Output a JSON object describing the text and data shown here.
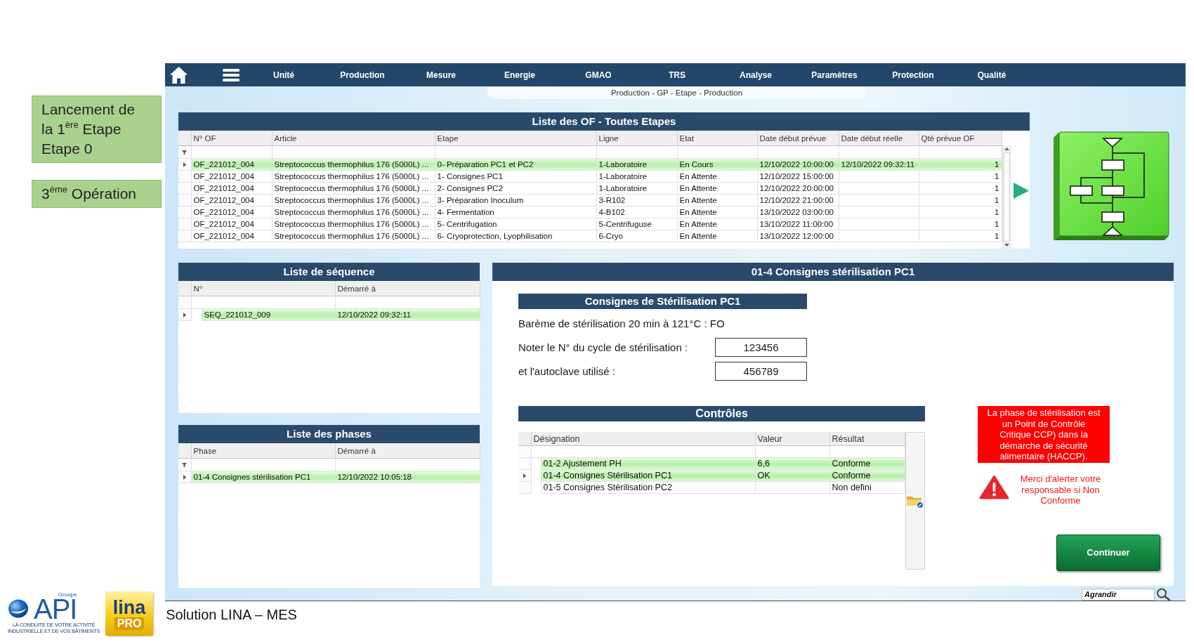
{
  "annotations": [
    {
      "lines": [
        "Lancement de la 1$^{ère}$ Etape",
        "Etape 0"
      ]
    },
    {
      "lines": [
        "3$^{ème}$ Opération"
      ]
    }
  ],
  "nav": {
    "items": [
      "Unité",
      "Production",
      "Mesure",
      "Energie",
      "GMAO",
      "TRS",
      "Analyse",
      "Paramètres",
      "Protection",
      "Qualité"
    ]
  },
  "breadcrumb": "Production - GP - Etape - Production",
  "of_list": {
    "title": "Liste des OF - Toutes Etapes",
    "columns": [
      "N° OF",
      "Article",
      "Etape",
      "Ligne",
      "Etat",
      "Date début prévue",
      "Date début réelle",
      "Qté prévue OF"
    ],
    "filter_icon": true,
    "rows": [
      {
        "selected": true,
        "highlighted": true,
        "cells": [
          "OF_221012_004",
          "Streptococcus thermophilus 176 (5000L) ...",
          "0- Préparation PC1 et PC2",
          "1-Laboratoire",
          "En Cours",
          "12/10/2022 10:00:00",
          "12/10/2022 09:32:11",
          "1"
        ]
      },
      {
        "selected": false,
        "highlighted": false,
        "cells": [
          "OF_221012_004",
          "Streptococcus thermophilus 176 (5000L) ...",
          "1- Consignes PC1",
          "1-Laboratoire",
          "En Attente",
          "12/10/2022 15:00:00",
          null,
          "1"
        ]
      },
      {
        "selected": false,
        "highlighted": false,
        "cells": [
          "OF_221012_004",
          "Streptococcus thermophilus 176 (5000L) ...",
          "2- Consignes PC2",
          "1-Laboratoire",
          "En Attente",
          "12/10/2022 20:00:00",
          null,
          "1"
        ]
      },
      {
        "selected": false,
        "highlighted": false,
        "cells": [
          "OF_221012_004",
          "Streptococcus thermophilus 176 (5000L) ...",
          "3- Préparation Inoculum",
          "3-R102",
          "En Attente",
          "12/10/2022 21:00:00",
          null,
          "1"
        ]
      },
      {
        "selected": false,
        "highlighted": false,
        "cells": [
          "OF_221012_004",
          "Streptococcus thermophilus 176 (5000L) ...",
          "4- Fermentation",
          "4-B102",
          "En Attente",
          "13/10/2022 03:00:00",
          null,
          "1"
        ]
      },
      {
        "selected": false,
        "highlighted": false,
        "cells": [
          "OF_221012_004",
          "Streptococcus thermophilus 176 (5000L) ...",
          "5- Centrifugation",
          "5-Centrifuguse",
          "En Attente",
          "13/10/2022 11:00:00",
          null,
          "1"
        ]
      },
      {
        "selected": false,
        "highlighted": false,
        "cells": [
          "OF_221012_004",
          "Streptococcus thermophilus 176 (5000L) ...",
          "6- Cryoprotection, Lyophilisation",
          "6-Cryo",
          "En Attente",
          "13/10/2022 12:00:00",
          null,
          "1"
        ]
      }
    ]
  },
  "sequence_list": {
    "title": "Liste de séquence",
    "columns": [
      "N°",
      "Démarré à"
    ],
    "filter_icon": false,
    "rows": [
      {
        "selected": true,
        "highlighted": true,
        "cells": [
          "SEQ_221012_009",
          "12/10/2022 09:32:11"
        ]
      }
    ]
  },
  "phase_list": {
    "title": "Liste des phases",
    "columns": [
      "Phase",
      "Démarré à"
    ],
    "filter_icon": true,
    "rows": [
      {
        "selected": true,
        "highlighted": true,
        "cells": [
          "01-4 Consignes stérilisation PC1",
          "12/10/2022 10:05:18"
        ]
      }
    ]
  },
  "detail": {
    "title": "01-4 Consignes stérilisation PC1",
    "instructions": {
      "title": "Consignes de Stérilisation PC1",
      "scale": "Barème de stérilisation 20 min à 121°C : FO",
      "fields": [
        {
          "label": "Noter le N° du cycle de stérilisation :",
          "value": "123456"
        },
        {
          "label": "et l'autoclave utilisé :",
          "value": "456789"
        }
      ]
    },
    "controls": {
      "title": "Contrôles",
      "columns": [
        "Désignation",
        "Valeur",
        "Résultat"
      ],
      "filter_icon": false,
      "rows": [
        {
          "selected": false,
          "highlighted": true,
          "cells": [
            "01-2 Ajustement PH",
            "6,6",
            "Conforme"
          ]
        },
        {
          "selected": true,
          "highlighted": true,
          "cells": [
            "01-4 Consignes Stérilisation PC1",
            "OK",
            "Conforme"
          ]
        },
        {
          "selected": false,
          "highlighted": false,
          "cells": [
            "01-5 Consignes Stérilisation PC2",
            null,
            "Non defini"
          ]
        }
      ]
    },
    "alert": "La phase de stérilisation est un Point de Contrôle Critique CCP) dans la démarche de sécurité alimentaire (HACCP).",
    "warning": "Merci d'alerter votre responsable si Non Conforme",
    "continue_button": "Continuer"
  },
  "zoom_field": {
    "value": "Agrandir"
  },
  "footer": {
    "api_logo": {
      "group": "Groupe",
      "name": "API",
      "tagline": [
        "LA CONDUITE DE VOTRE ACTIVITÉ",
        "INDUSTRIELLE ET DE VOS BÂTIMENTS"
      ]
    },
    "lina_logo": {
      "name": "lina",
      "edition": "PRO"
    },
    "caption": "Solution LINA – MES"
  }
}
